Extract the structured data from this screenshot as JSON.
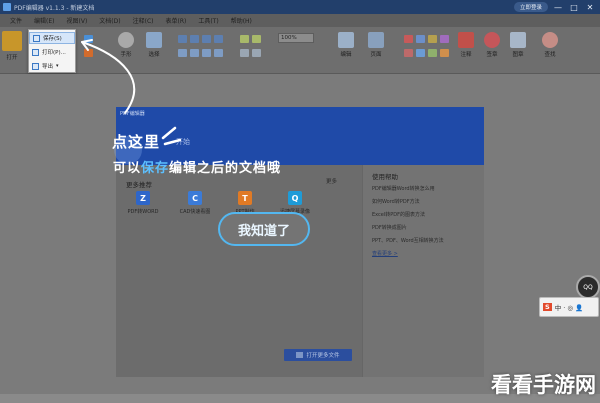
{
  "window": {
    "title": "PDF编辑器 v1.1.3 - 新建文档",
    "login": "立即登录",
    "controls": [
      "—",
      "□",
      "✕"
    ]
  },
  "menu": [
    "文件",
    "编辑(E)",
    "视图(V)",
    "文档(D)",
    "注释(C)",
    "表单(R)",
    "工具(T)",
    "帮助(H)"
  ],
  "toolbar": {
    "open_label": "打开",
    "zoom_value": "100%",
    "buttons": [
      "手形",
      "选择",
      "编辑",
      "页面",
      "注释",
      "签章",
      "图章",
      "查找"
    ]
  },
  "file_menu": {
    "items": [
      {
        "label": "保存(S)",
        "highlighted": true
      },
      {
        "label": "打印(P)...",
        "highlighted": true
      },
      {
        "label": "导出",
        "has_caret": true
      }
    ]
  },
  "start_panel": {
    "header_small": "PDF编辑器",
    "header_big": "开始",
    "recommend_title": "更多推荐",
    "more_label": "更多",
    "apps": [
      {
        "icon_letter": "Z",
        "color": "#2e66c9",
        "label": "PDF转WORD"
      },
      {
        "icon_letter": "C",
        "color": "#3b7bd8",
        "label": "CAD快速看图"
      },
      {
        "icon_letter": "T",
        "color": "#e07a25",
        "label": "PPT制作"
      },
      {
        "icon_letter": "Q",
        "color": "#1e9bd7",
        "label": "迅捷屏幕录像"
      }
    ],
    "help_title": "使用帮助",
    "help_items": [
      "PDF编辑器Word转换怎么用",
      "如何Word转PDF方法",
      "Excel转PDF的图表方法",
      "PDF转换成图片",
      "PPT、PDF、Word互相转换方法"
    ],
    "help_more": "查看更多 >",
    "open_file_button": "打开更多文件"
  },
  "annotations": {
    "line1": "点这里",
    "line2_pre": "可以",
    "line2_highlight": "保存",
    "line2_post": "编辑之后的文档哦",
    "ok_button": "我知道了"
  },
  "side_widget": {
    "brand": "S",
    "text": "中 · ◎ 👤",
    "circle_text": "QQ"
  },
  "watermark": "看看手游网"
}
